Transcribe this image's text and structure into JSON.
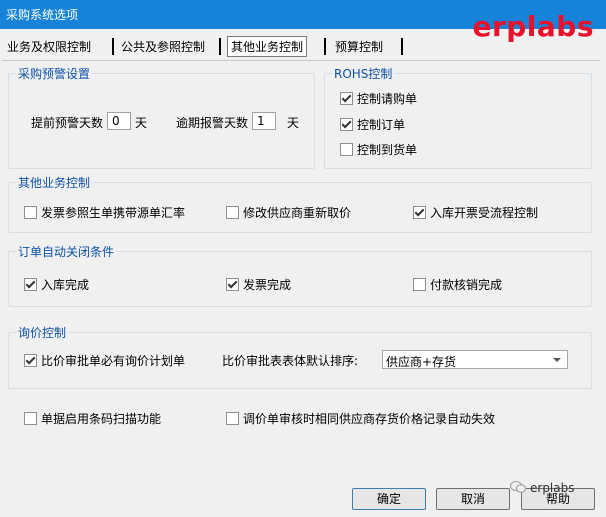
{
  "window": {
    "title": "采购系统选项"
  },
  "watermark": {
    "text": "erplabs",
    "bottom_text": "erplabs",
    "color": "#e8102a"
  },
  "tabs": [
    {
      "label": "业务及权限控制"
    },
    {
      "label": "公共及参照控制"
    },
    {
      "label": "其他业务控制",
      "active": true
    },
    {
      "label": "预算控制"
    }
  ],
  "purchase_warning": {
    "legend": "采购预警设置",
    "advance_days_label": "提前预警天数",
    "advance_days_value": "0",
    "advance_days_unit": "天",
    "overdue_days_label": "逾期报警天数",
    "overdue_days_value": "1",
    "overdue_days_unit": "天"
  },
  "rohs": {
    "legend": "ROHS控制",
    "items": [
      {
        "label": "控制请购单",
        "checked": true
      },
      {
        "label": "控制订单",
        "checked": true
      },
      {
        "label": "控制到货单",
        "checked": false
      }
    ]
  },
  "other_control": {
    "legend": "其他业务控制",
    "items": [
      {
        "label": "发票参照生单携带源单汇率",
        "checked": false
      },
      {
        "label": "修改供应商重新取价",
        "checked": false
      },
      {
        "label": "入库开票受流程控制",
        "checked": true
      }
    ]
  },
  "order_close": {
    "legend": "订单自动关闭条件",
    "items": [
      {
        "label": "入库完成",
        "checked": true
      },
      {
        "label": "发票完成",
        "checked": true
      },
      {
        "label": "付款核销完成",
        "checked": false
      }
    ]
  },
  "inquiry": {
    "legend": "询价控制",
    "must_plan": {
      "label": "比价审批单必有询价计划单",
      "checked": true
    },
    "sort_label": "比价审批表表体默认排序:",
    "sort_value": "供应商+存货"
  },
  "barcode": {
    "label": "单据启用条码扫描功能",
    "checked": false
  },
  "price_invalid": {
    "label": "调价单审核时相同供应商存货价格记录自动失效",
    "checked": false
  },
  "buttons": {
    "ok": "确定",
    "cancel": "取消",
    "help": "帮助"
  },
  "colors": {
    "titlebar": "#1683d8",
    "legend": "#0e52a8",
    "window_bg": "#f0f0f0"
  }
}
